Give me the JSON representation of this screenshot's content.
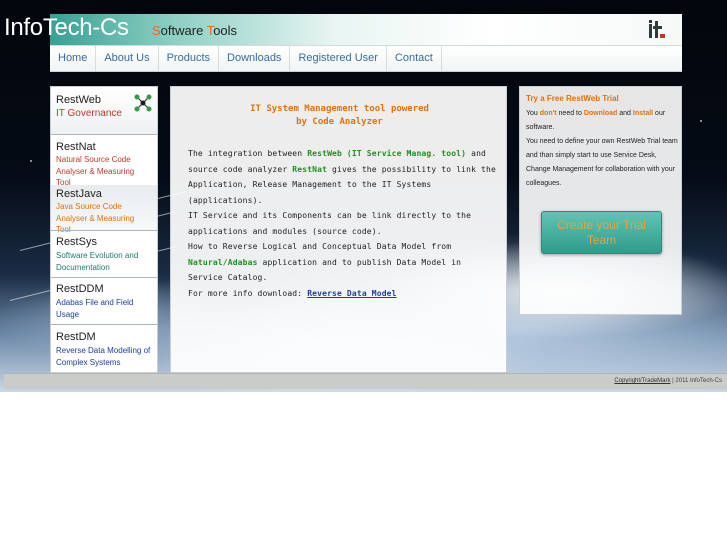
{
  "header": {
    "logo_text": "InfoTech-Cs",
    "tagline": {
      "s1": "S",
      "rest1": "oftware ",
      "t1": "T",
      "rest2": "ools"
    },
    "brand_mark_icon": "it-logo-icon",
    "band_colors": {
      "teal": "#38a093",
      "white": "#ffffff"
    }
  },
  "nav": {
    "items": [
      "Home",
      "About Us",
      "Products",
      "Downloads",
      "Registered User",
      "Contact"
    ]
  },
  "left_menu": {
    "items": [
      {
        "title": "RestWeb",
        "subtitle": "IT Governance",
        "subtitle_color": "#c0392b",
        "icon": "network-nodes-icon"
      },
      {
        "title": "RestNat",
        "subtitle": "Natural Source Code Analyser & Measuring Tool",
        "subtitle_color": "#c0392b"
      },
      {
        "title": "RestJava",
        "subtitle": "Java Source Code Analyser & Measuring Tool",
        "subtitle_color": "#e0710e"
      },
      {
        "title": "RestSys",
        "subtitle": "Software Evolution and Documentation",
        "subtitle_color": "#1f7a6b"
      },
      {
        "title": "RestDDM",
        "subtitle": "Adabas File and Field Usage",
        "subtitle_color": "#1d3e9a"
      },
      {
        "title": "RestDM",
        "subtitle": "Reverse Data Modelling of Complex Systems",
        "subtitle_color": "#1d3e9a"
      }
    ]
  },
  "main": {
    "heading_line1": "IT System Management tool powered",
    "heading_line2": "by Code Analyzer",
    "p1_a": "The integration between ",
    "p1_restweb": "RestWeb (IT Service Manag. tool)",
    "p1_b": " and source code analyzer ",
    "p1_restnat": "RestNat",
    "p1_c": " gives the possibility to link the Application, Release Management to the IT Systems (applications).",
    "p2": "IT Service and its Components can be link directly to the applications and modules (source code).",
    "p3_a": "How to Reverse Logical and Conceptual Data Model from ",
    "p3_natural": "Natural/Adabas",
    "p3_b": " application and to publish Data Model in Service Catalog.",
    "p4_a": "For more info download: ",
    "p4_link": "Reverse Data Model"
  },
  "trial": {
    "title": "Try a Free RestWeb Trial",
    "line1_a": "You ",
    "line1_dont": "don't",
    "line1_b": " need to ",
    "line1_download": "Download",
    "line1_c": " and ",
    "line1_install": "Install",
    "line1_d": " our software.",
    "line2": "You need to define your own RestWeb Trial team and than simply start to use Service Desk, Change Management for collaboration with your colleagues.",
    "button_label": "Create your Trial Team"
  },
  "footer": {
    "copyright_link": "Copyright/TradeMark",
    "suffix": " | 2011 InfoTech-Cs"
  }
}
